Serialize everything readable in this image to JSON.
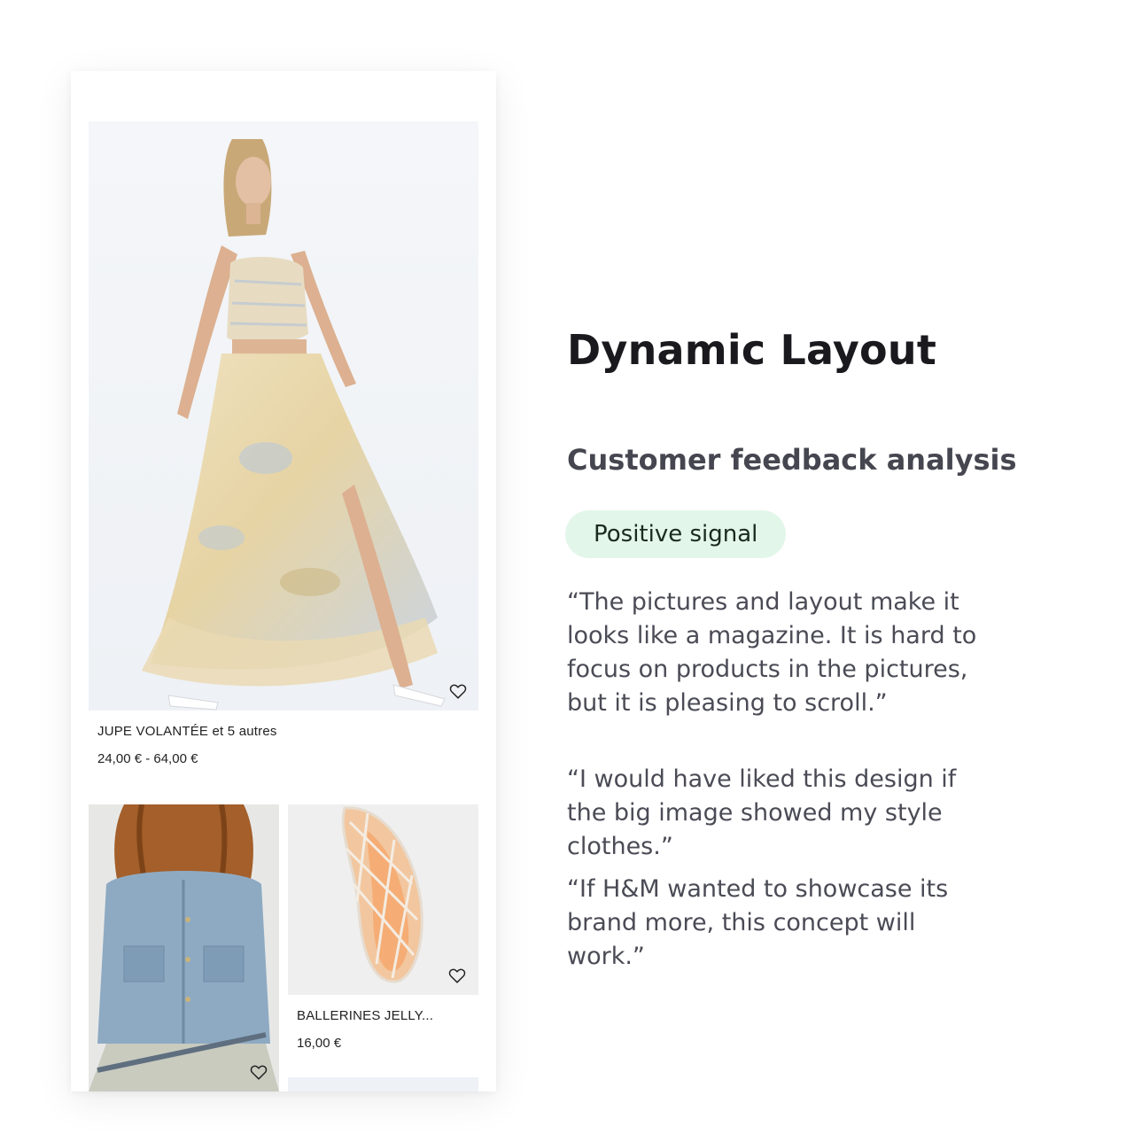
{
  "feed": {
    "hero": {
      "image": "model-in-floral-ruffled-skirt",
      "name": "JUPE VOLANTÉE et 5 autres",
      "price": "24,00 € - 64,00 €",
      "favorite_icon": "heart-outline-icon"
    },
    "tiles": [
      {
        "image": "denim-jacket-fringe-skirt",
        "favorite_icon": "heart-outline-icon"
      },
      {
        "image": "orange-jelly-ballerina",
        "name": "BALLERINES JELLY...",
        "price": "16,00 €",
        "favorite_icon": "heart-outline-icon"
      }
    ]
  },
  "panel": {
    "title": "Dynamic Layout",
    "subtitle": "Customer feedback analysis",
    "badge": "Positive signal",
    "badge_color": "#e3f6ea",
    "quotes": [
      "“The pictures and layout make it looks like a magazine. It is hard to focus on products in the pictures, but it is pleasing to scroll.”",
      "“I would have liked this design if the big image showed my style clothes.”",
      "“If H&M wanted to showcase its brand more, this concept will work.”"
    ]
  }
}
